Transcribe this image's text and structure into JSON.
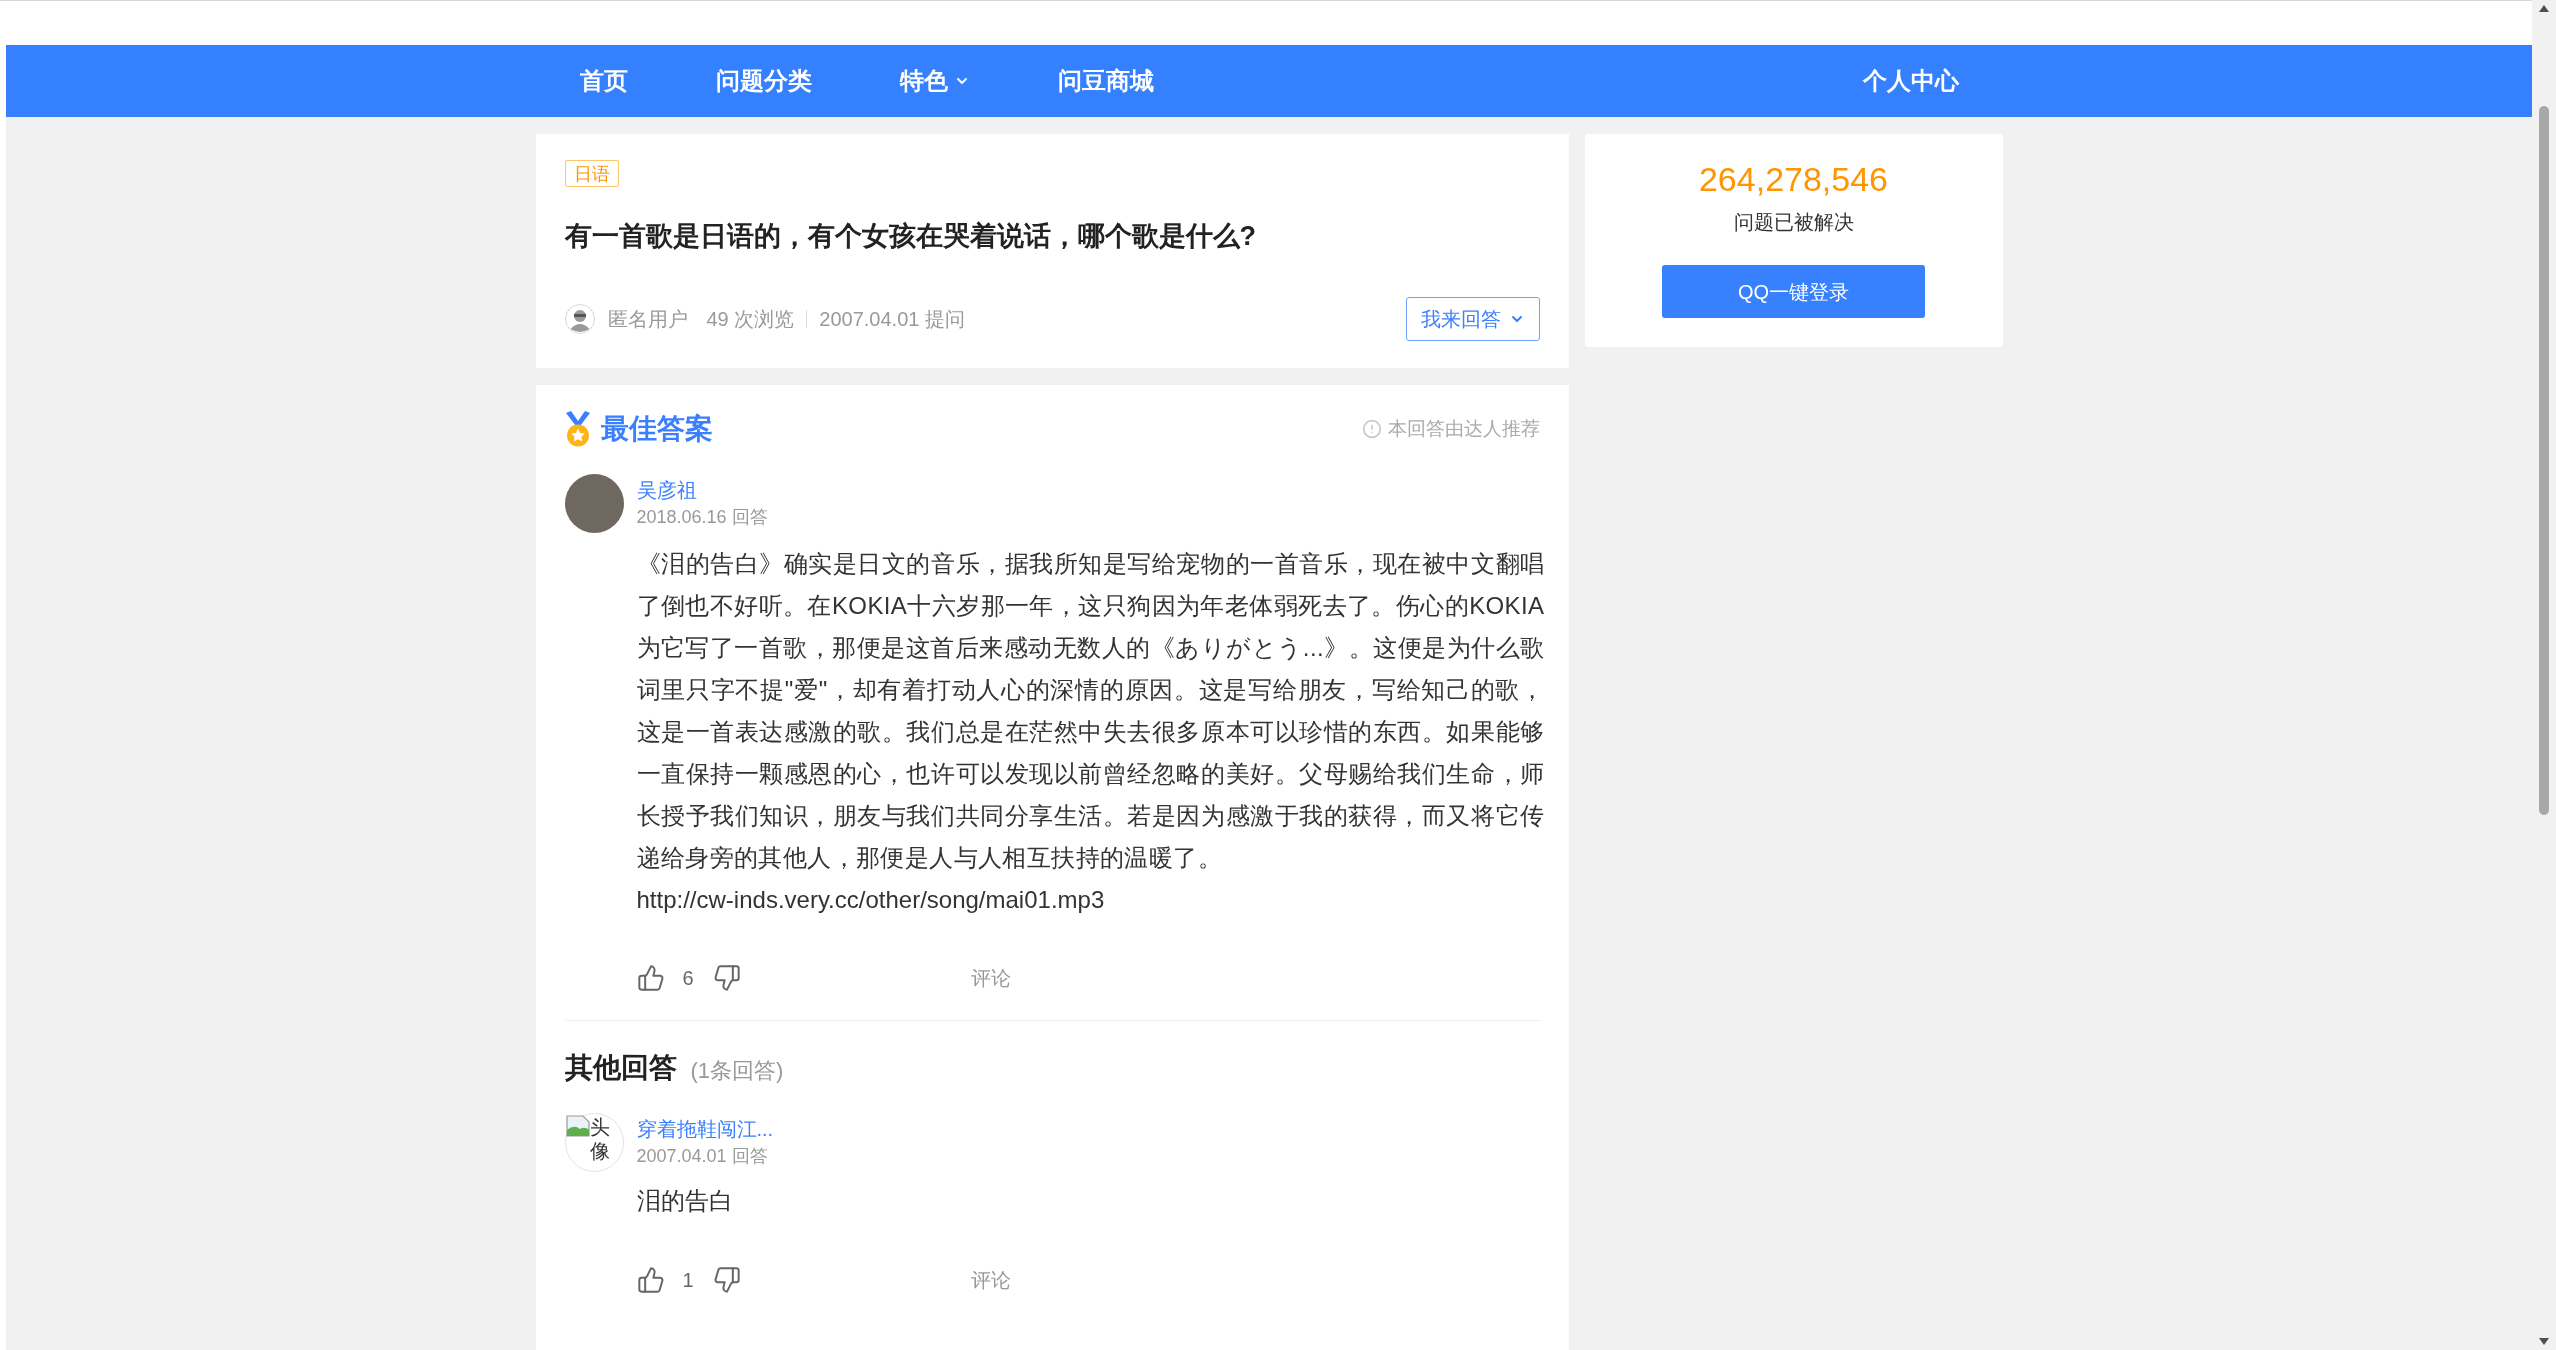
{
  "nav": {
    "items": [
      {
        "label": "首页",
        "kind": "link"
      },
      {
        "label": "问题分类",
        "kind": "link"
      },
      {
        "label": "特色",
        "kind": "menu"
      },
      {
        "label": "问豆商城",
        "kind": "link"
      }
    ],
    "user_center": "个人中心"
  },
  "question": {
    "tag": "日语",
    "title": "有一首歌是日语的，有个女孩在哭着说话，哪个歌是什么?",
    "asker": "匿名用户",
    "views": "49 次浏览",
    "asked": "2007.04.01 提问",
    "answer_button": "我来回答"
  },
  "best_answer": {
    "heading": "最佳答案",
    "recommend_note": "本回答由达人推荐",
    "author": "吴彦祖",
    "date": "2018.06.16 回答",
    "text": "《泪的告白》确实是日文的音乐，据我所知是写给宠物的一首音乐，现在被中文翻唱了倒也不好听。在KOKIA十六岁那一年，这只狗因为年老体弱死去了。伤心的KOKIA为它写了一首歌，那便是这首后来感动无数人的《ありがとう...》。这便是为什么歌词里只字不提\"爱\"，却有着打动人心的深情的原因。这是写给朋友，写给知己的歌，这是一首表达感激的歌。我们总是在茫然中失去很多原本可以珍惜的东西。如果能够一直保持一颗感恩的心，也许可以发现以前曾经忽略的美好。父母赐给我们生命，师长授予我们知识，朋友与我们共同分享生活。若是因为感激于我的获得，而又将它传递给身旁的其他人，那便是人与人相互扶持的温暖了。",
    "link": "http://cw-inds.very.cc/other/song/mai01.mp3",
    "likes": "6",
    "comment": "评论"
  },
  "other_answers": {
    "heading": "其他回答",
    "count": "(1条回答)",
    "answers": [
      {
        "author": "穿着拖鞋闯江...",
        "avatar_alt": "头像",
        "date": "2007.04.01 回答",
        "text": "泪的告白",
        "likes": "1",
        "comment": "评论"
      }
    ]
  },
  "sidebar": {
    "solved_count": "264,278,546",
    "solved_label": "问题已被解决",
    "login_button": "QQ一键登录"
  }
}
